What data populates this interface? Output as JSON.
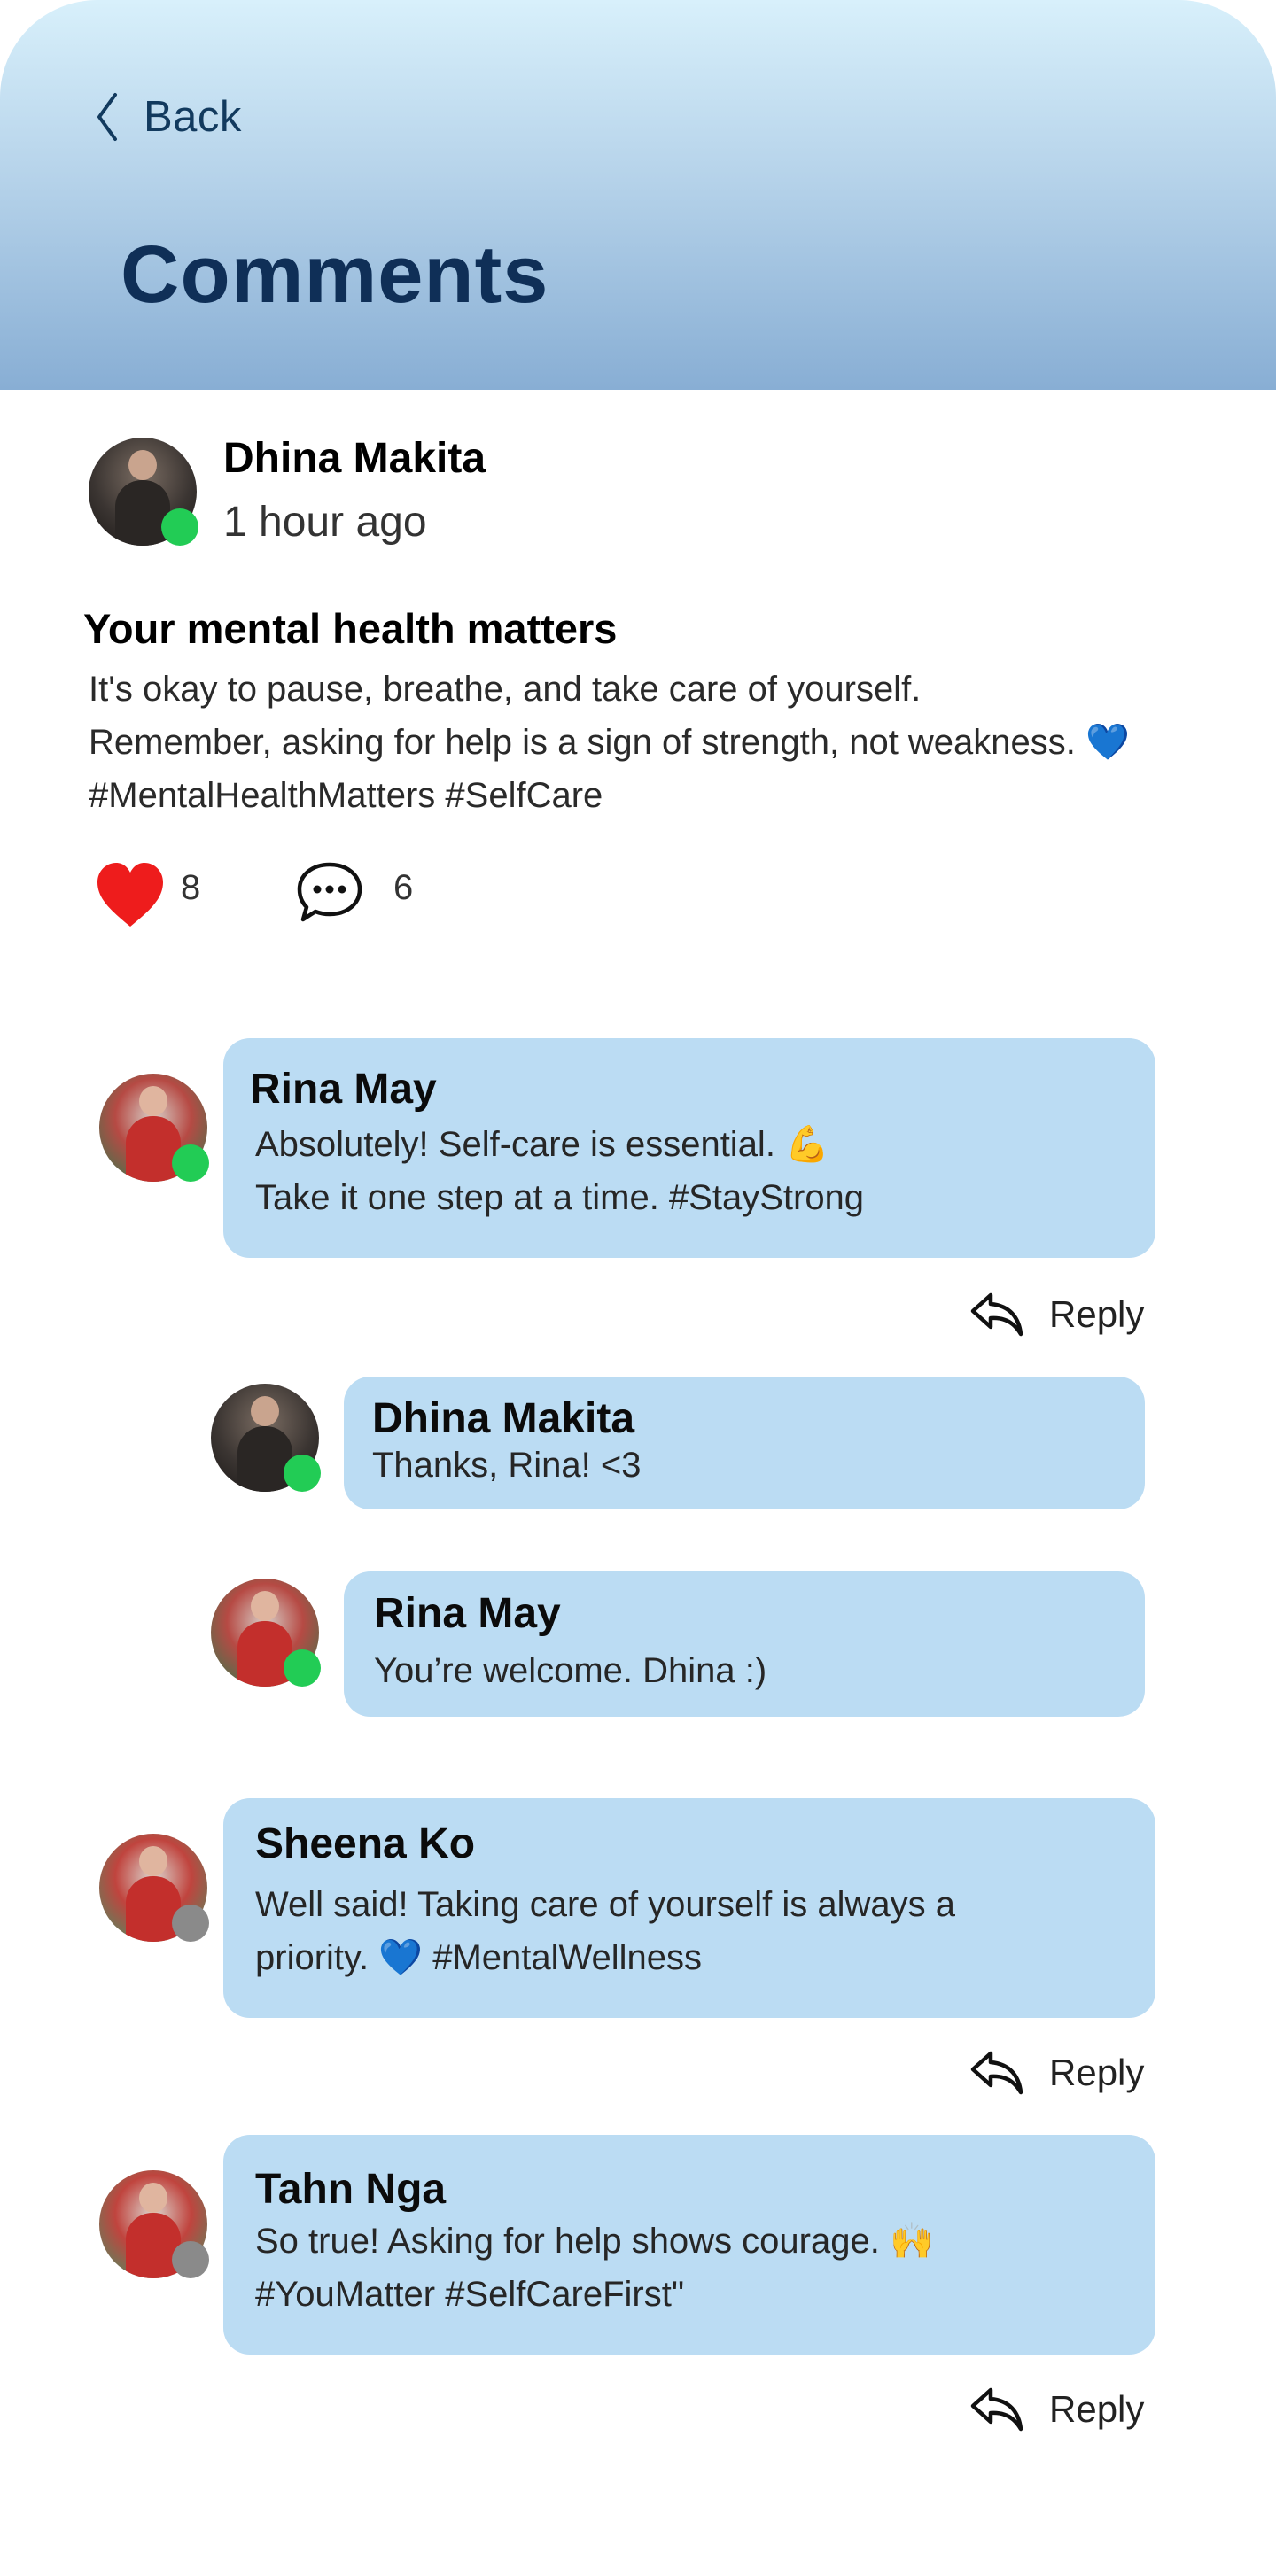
{
  "header": {
    "back_label": "Back",
    "title": "Comments"
  },
  "post": {
    "author": "Dhina Makita",
    "time": "1 hour ago",
    "title": "Your mental health matters",
    "body_lines": [
      "It's okay to pause, breathe, and take care of yourself.",
      "Remember, asking for help is a sign of strength, not weakness. 💙",
      "#MentalHealthMatters #SelfCare"
    ],
    "likes": "8",
    "comments": "6"
  },
  "comments": [
    {
      "name": "Rina May",
      "lines": [
        "Absolutely! Self-care is essential. 💪",
        "Take it one step at a time. #StayStrong"
      ],
      "online": true,
      "reply_label": "Reply",
      "replies": [
        {
          "name": "Dhina Makita",
          "lines": [
            "Thanks, Rina! <3"
          ],
          "online": true
        },
        {
          "name": "Rina May",
          "lines": [
            "You’re welcome. Dhina :)"
          ],
          "online": true
        }
      ]
    },
    {
      "name": "Sheena Ko",
      "lines": [
        "Well said! Taking care of yourself is always a",
        "priority.  💙 #MentalWellness"
      ],
      "online": false,
      "reply_label": "Reply"
    },
    {
      "name": "Tahn Nga",
      "lines": [
        "So true! Asking for help shows courage. 🙌",
        "#YouMatter #SelfCareFirst\""
      ],
      "online": false,
      "reply_label": "Reply"
    }
  ],
  "colors": {
    "online": "#22cc55",
    "offline": "#8a8a8a",
    "bubble": "#bbdcf3",
    "like": "#ee1c1c",
    "title": "#0f2f57"
  },
  "icons": [
    "back-chevron-icon",
    "heart-icon",
    "chat-bubble-icon",
    "reply-arrow-icon"
  ]
}
